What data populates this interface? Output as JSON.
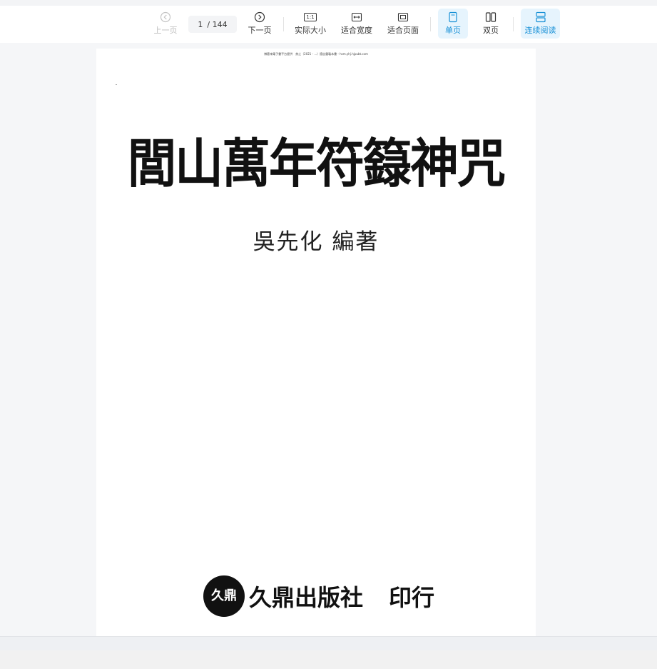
{
  "toolbar": {
    "prev_label": "上一页",
    "next_label": "下一页",
    "page_current": "1",
    "page_total": "/ 144",
    "actual_size_label": "实际大小",
    "fit_width_label": "适合宽度",
    "fit_page_label": "适合页面",
    "single_page_label": "单页",
    "double_page_label": "双页",
    "continuous_label": "连续阅读",
    "actual_size_icon_text": "1:1"
  },
  "colors": {
    "accent": "#1890d6",
    "active_bg": "#e6f4fd",
    "disabled": "#bdbdbd"
  },
  "document": {
    "watermark": "博客來電子書平台提供　禁止（2021 - ...）擅自重製本書 - hsm.yhj.hjpubt.com",
    "title": "閭山萬年符籙神咒",
    "author": "吳先化 編著",
    "publisher_logo_text": "久鼎",
    "publisher_name": "久鼎出版社",
    "publisher_action": "印行"
  }
}
